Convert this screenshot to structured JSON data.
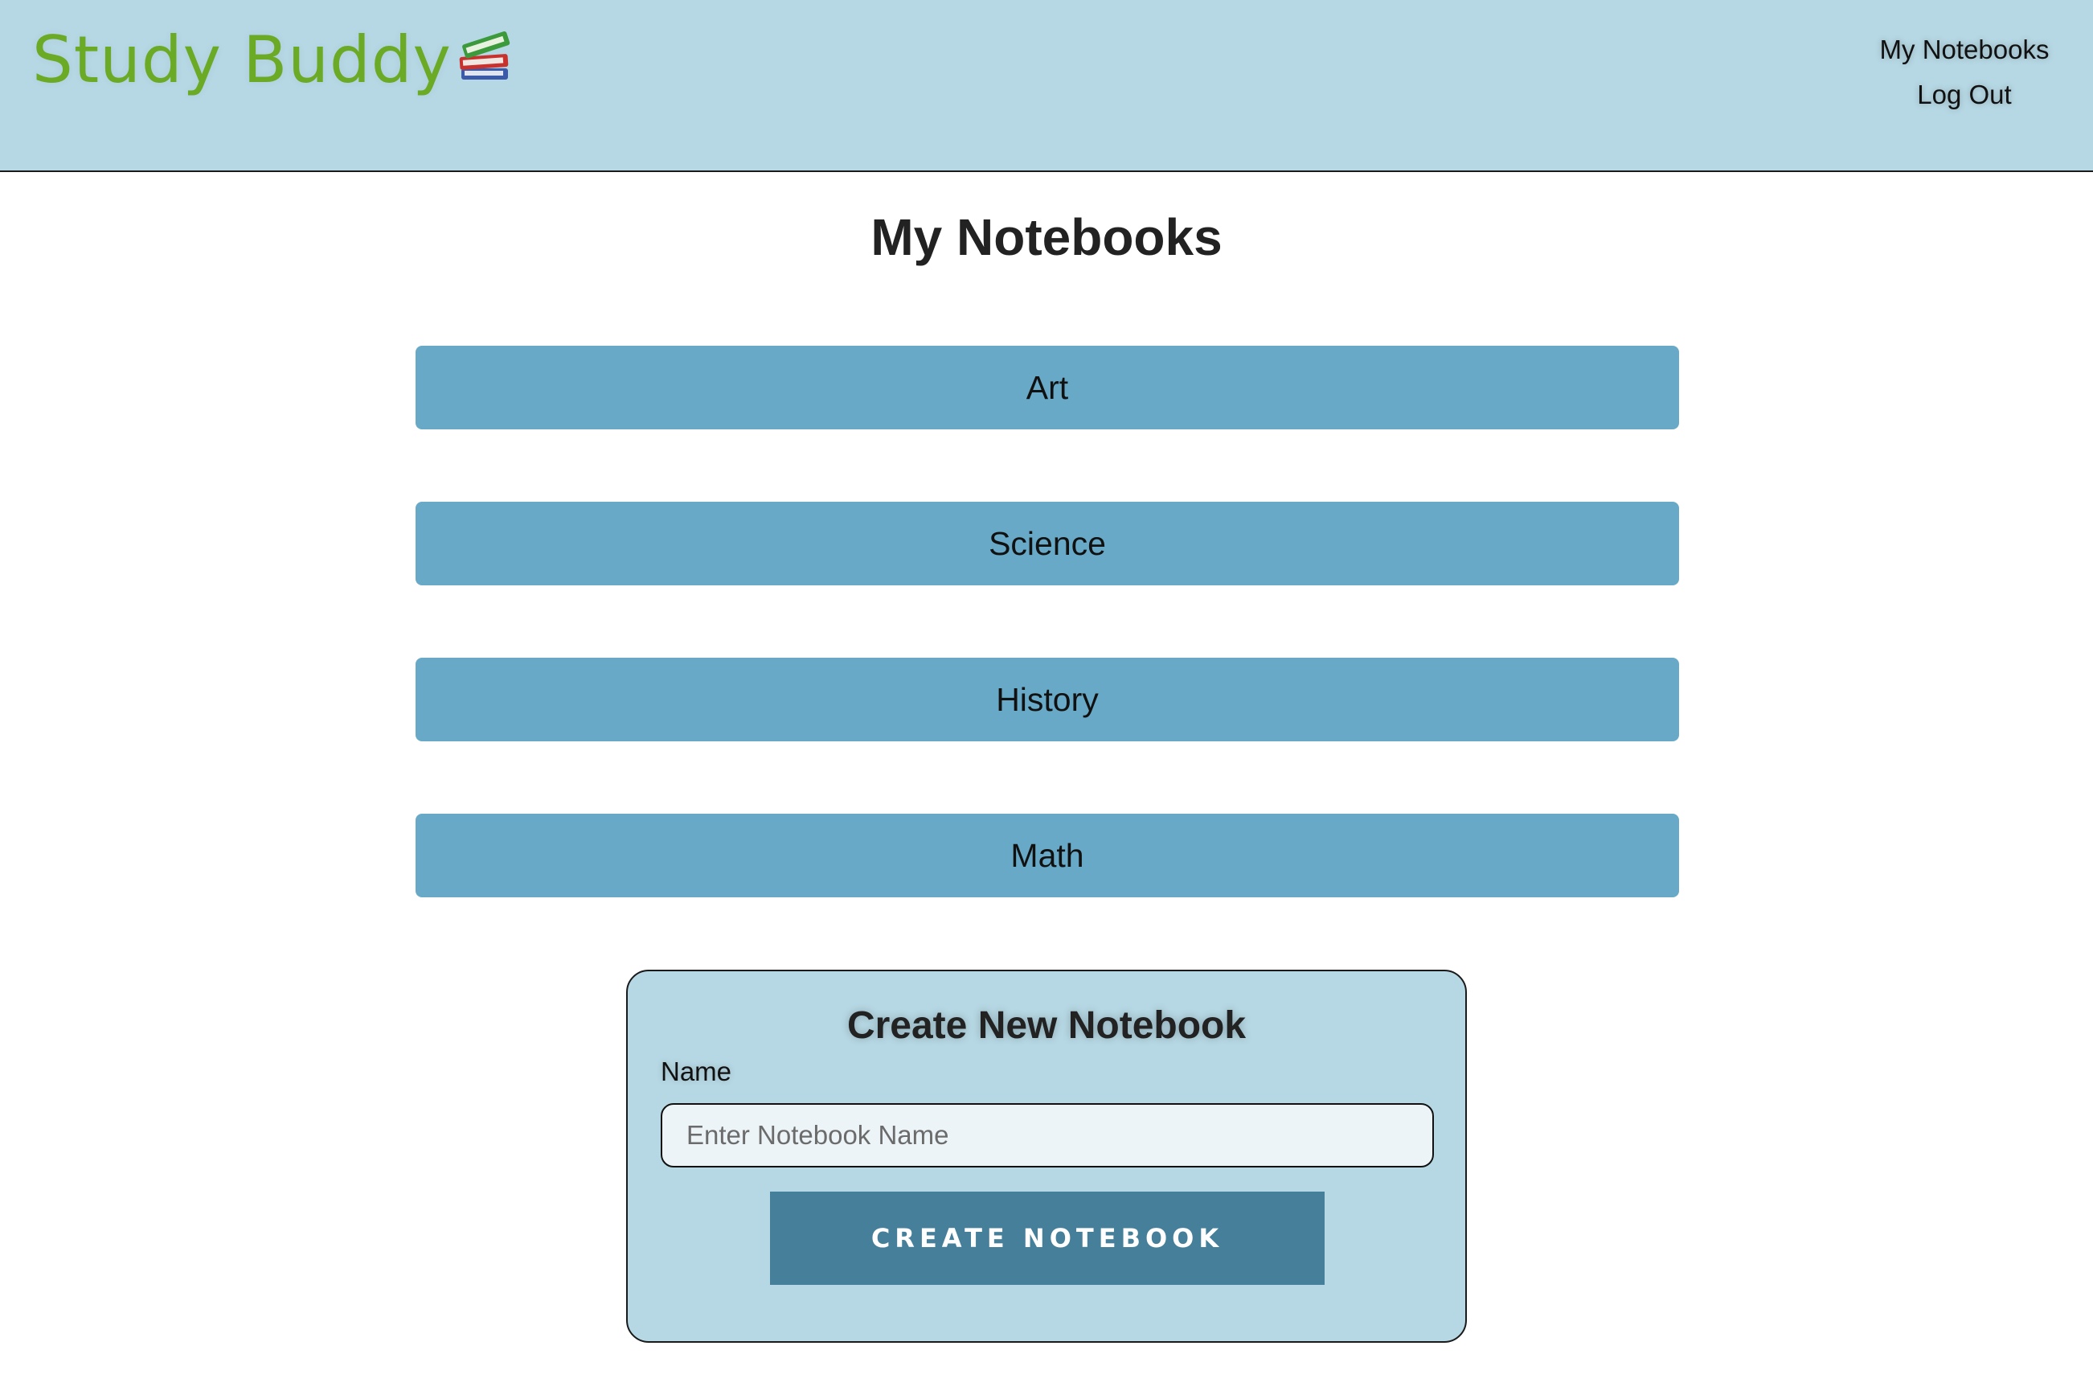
{
  "header": {
    "brand": "Study Buddy",
    "brand_icon": "books-icon",
    "nav": {
      "my_notebooks": "My Notebooks",
      "log_out": "Log Out"
    }
  },
  "main": {
    "title": "My Notebooks",
    "notebooks": [
      {
        "label": "Art"
      },
      {
        "label": "Science"
      },
      {
        "label": "History"
      },
      {
        "label": "Math"
      }
    ]
  },
  "create_form": {
    "title": "Create New Notebook",
    "name_label": "Name",
    "name_value": "",
    "name_placeholder": "Enter Notebook Name",
    "submit_label": "CREATE NOTEBOOK"
  },
  "colors": {
    "header_bg": "#b6d8e4",
    "brand_green": "#6aaa24",
    "notebook_button": "#67a9c6",
    "create_button": "#467f99"
  }
}
